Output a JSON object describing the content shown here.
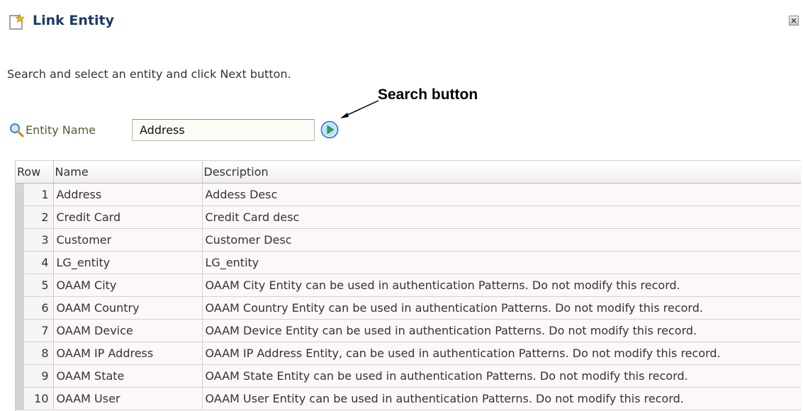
{
  "dialog": {
    "title": "Link Entity",
    "instructions": "Search and select an entity and click Next button."
  },
  "annotation": {
    "label": "Search button"
  },
  "search": {
    "label": "Entity Name",
    "value": "Address"
  },
  "table": {
    "columns": [
      "Row",
      "Name",
      "Description"
    ],
    "rows": [
      {
        "row": "1",
        "name": "Address",
        "description": "Addess Desc"
      },
      {
        "row": "2",
        "name": "Credit Card",
        "description": "Credit Card desc"
      },
      {
        "row": "3",
        "name": "Customer",
        "description": "Customer Desc"
      },
      {
        "row": "4",
        "name": "LG_entity",
        "description": "LG_entity"
      },
      {
        "row": "5",
        "name": "OAAM City",
        "description": "OAAM City Entity can be used in authentication Patterns. Do not modify this record."
      },
      {
        "row": "6",
        "name": "OAAM Country",
        "description": "OAAM Country Entity can be used in authentication Patterns. Do not modify this record."
      },
      {
        "row": "7",
        "name": "OAAM Device",
        "description": "OAAM Device Entity can be used in authentication Patterns. Do not modify this record."
      },
      {
        "row": "8",
        "name": "OAAM IP Address",
        "description": "OAAM IP Address Entity, can be used in authentication Patterns. Do not modify this record."
      },
      {
        "row": "9",
        "name": "OAAM State",
        "description": "OAAM State Entity can be used in authentication Patterns. Do not modify this record."
      },
      {
        "row": "10",
        "name": "OAAM User",
        "description": "OAAM User Entity can be used in authentication Patterns. Do not modify this record."
      }
    ]
  },
  "icons": {
    "title": "new-document-star-icon",
    "close": "close-icon",
    "search": "magnifier-icon",
    "go": "play-arrow-icon"
  },
  "colors": {
    "title_text": "#1b3a6b",
    "go_button": "#2f7fd0",
    "row_background": "#fdf7f7"
  }
}
